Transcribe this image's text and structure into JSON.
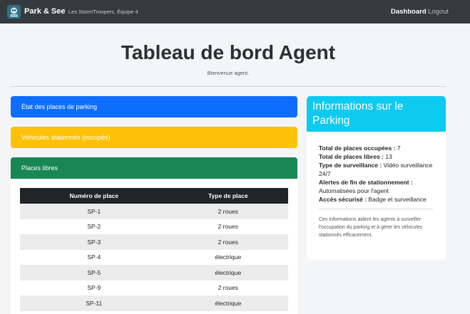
{
  "navbar": {
    "brand": "Park & See",
    "team": "Les StormTroopers, Équipe 4",
    "links": {
      "dashboard": "Dashboard",
      "logout": "Logout"
    }
  },
  "header": {
    "title": "Tableau de bord Agent",
    "welcome": "Bienvenue agent."
  },
  "panels": {
    "status": "État des places de parking",
    "occupied": "Véhicules stationnés (occupés)",
    "free": "Places libres"
  },
  "free_table": {
    "columns": [
      "Numéro de place",
      "Type de place"
    ],
    "rows": [
      [
        "SP-1",
        "2 roues"
      ],
      [
        "SP-2",
        "2 roues"
      ],
      [
        "SP-3",
        "2 roues"
      ],
      [
        "SP-4",
        "électrique"
      ],
      [
        "SP-5",
        "électrique"
      ],
      [
        "SP-9",
        "2 roues"
      ],
      [
        "SP-11",
        "électrique"
      ]
    ]
  },
  "info": {
    "title": "Informations sur le Parking",
    "items": [
      {
        "label": "Total de places occupées :",
        "value": "7"
      },
      {
        "label": "Total de places libres :",
        "value": "13"
      },
      {
        "label": "Type de surveillance :",
        "value": "Vidéo surveillance 24/7"
      },
      {
        "label": "Alertes de fin de stationnement :",
        "value": "Automatisées pour l'agent"
      },
      {
        "label": "Accès sécurisé :",
        "value": "Badge et surveillance"
      }
    ],
    "note": "Ces informations aident les agents à surveiller l'occupation du parking et à gérer les véhicules stationnés efficacement."
  },
  "colors": {
    "navbar": "#343a40",
    "blue": "#0d6efd",
    "yellow": "#ffc107",
    "green": "#198754",
    "cyan": "#0dcaf0",
    "table_header": "#212529"
  },
  "icons": {
    "logo": "parking-robot-logo-icon"
  }
}
